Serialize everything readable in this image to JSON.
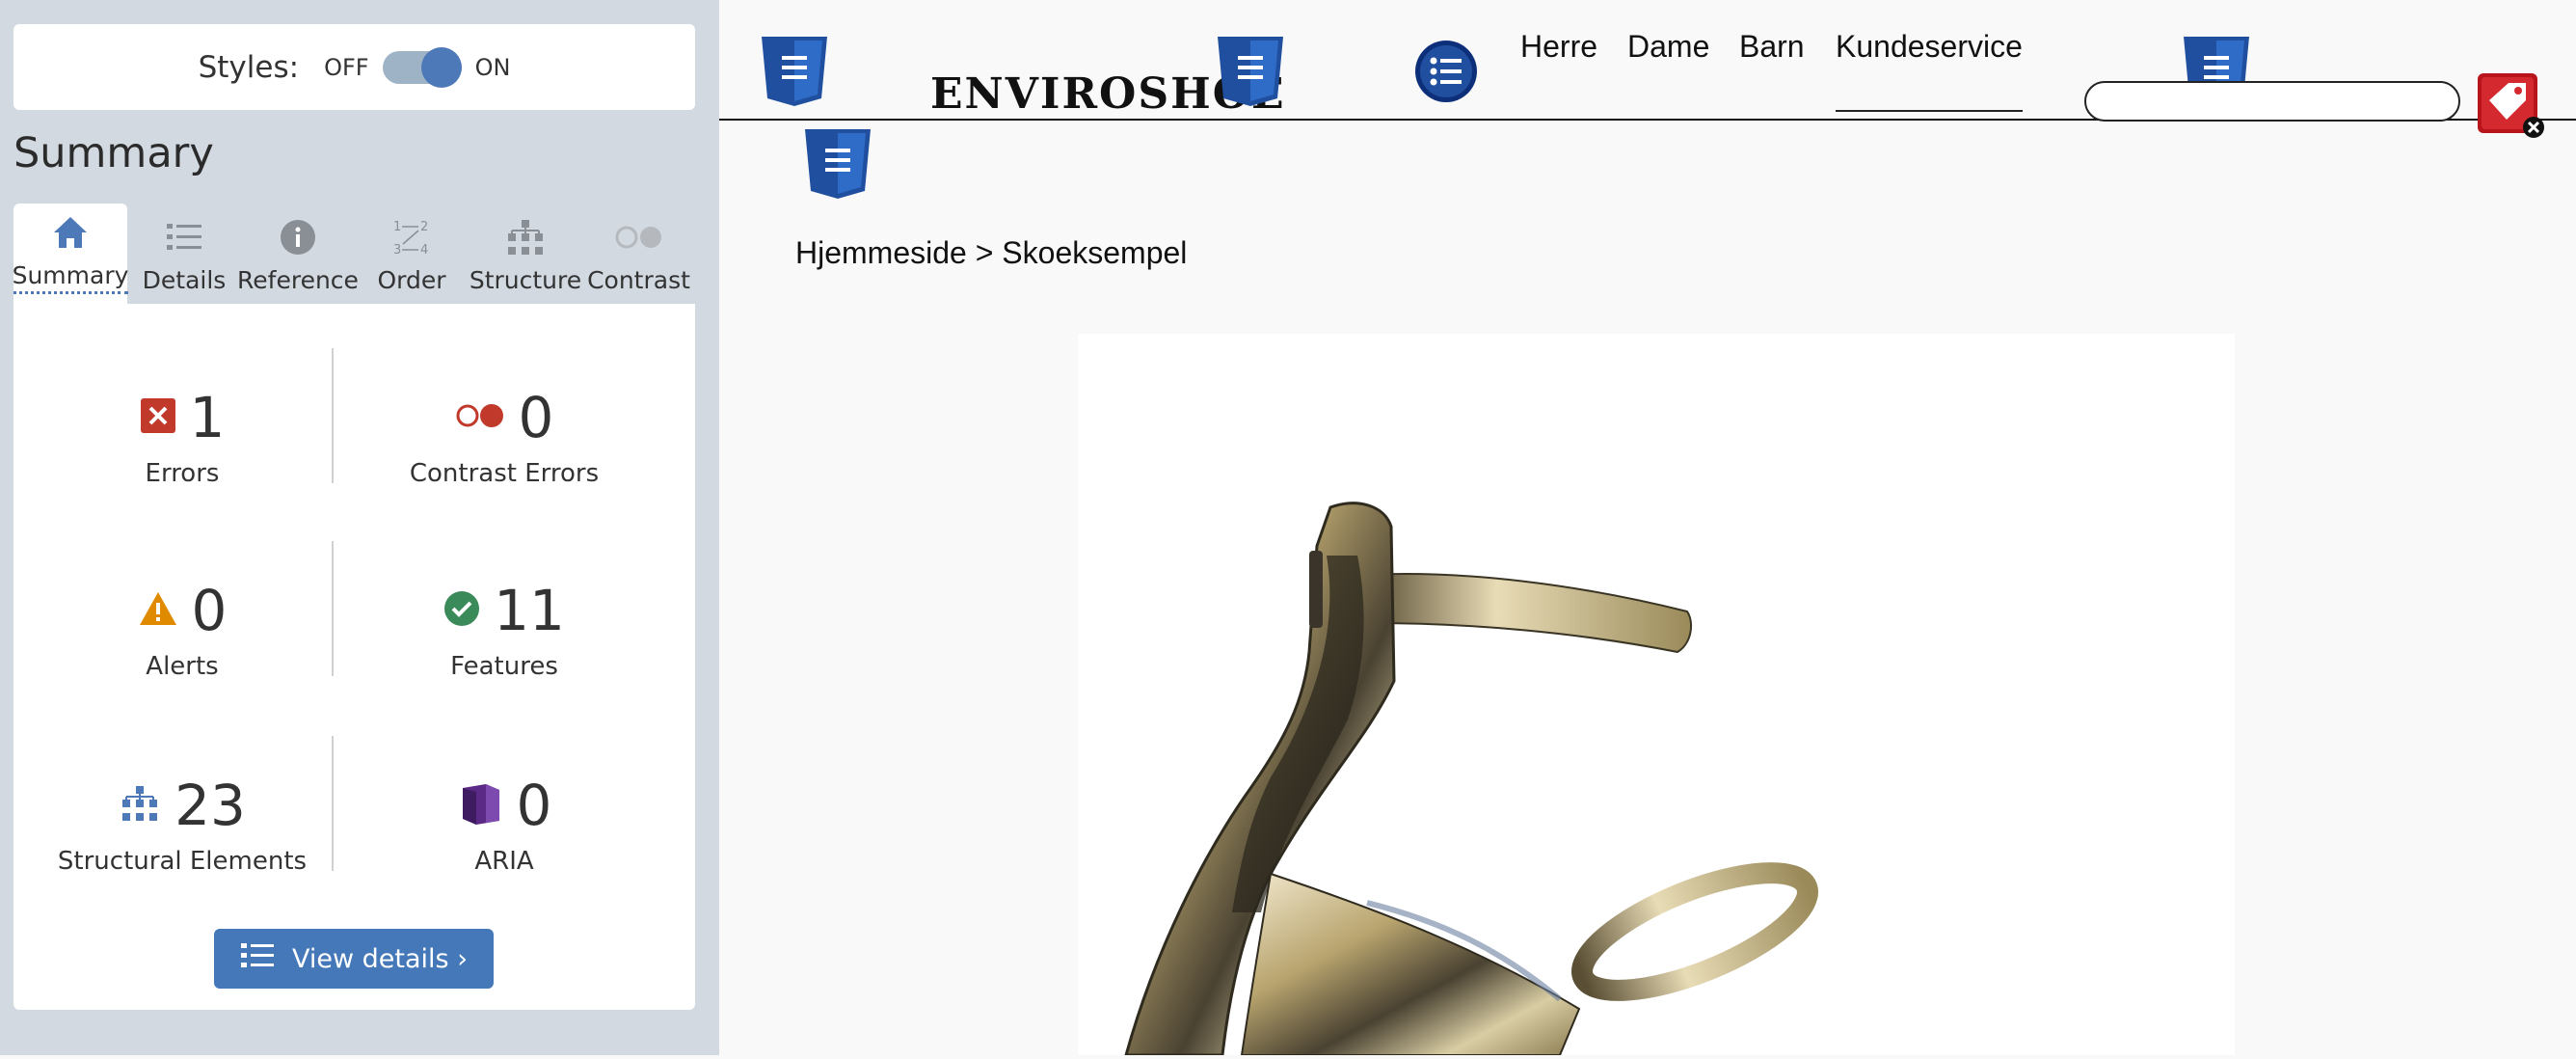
{
  "sidebar": {
    "styles": {
      "label": "Styles:",
      "off": "OFF",
      "on": "ON"
    },
    "summary_title": "Summary",
    "tabs": [
      {
        "label": "Summary",
        "icon": "home-icon"
      },
      {
        "label": "Details",
        "icon": "list-icon"
      },
      {
        "label": "Reference",
        "icon": "info-icon"
      },
      {
        "label": "Order",
        "icon": "order-icon"
      },
      {
        "label": "Structure",
        "icon": "structure-icon"
      },
      {
        "label": "Contrast",
        "icon": "contrast-icon"
      }
    ],
    "stats": {
      "errors": {
        "value": "1",
        "label": "Errors"
      },
      "contrast_errors": {
        "value": "0",
        "label": "Contrast Errors"
      },
      "alerts": {
        "value": "0",
        "label": "Alerts"
      },
      "features": {
        "value": "11",
        "label": "Features"
      },
      "structural": {
        "value": "23",
        "label": "Structural Elements"
      },
      "aria": {
        "value": "0",
        "label": "ARIA"
      }
    },
    "view_details": "View details ›",
    "colors": {
      "accent": "#4578b8",
      "error": "#c0392b",
      "alert": "#e08a00",
      "feature": "#3a8a5a",
      "aria": "#5b2a86"
    }
  },
  "site": {
    "logo": "ENVIROSHOE",
    "nav": [
      "Herre",
      "Dame",
      "Barn",
      "Kundeservice"
    ],
    "search_placeholder": "",
    "breadcrumb": "Hjemmeside > Skoeksempel"
  }
}
